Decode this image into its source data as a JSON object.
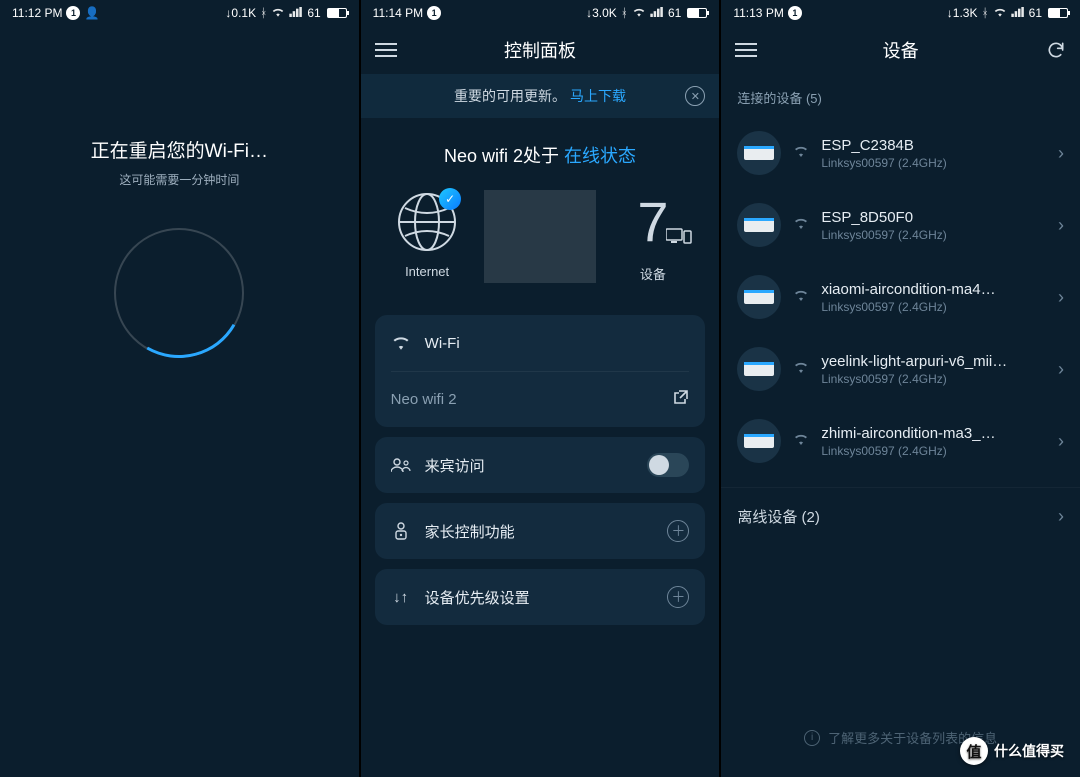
{
  "statusbar": {
    "s1": {
      "time": "11:12 PM",
      "notif": "1",
      "net": "↓0.1K",
      "battery_pct": 61,
      "battery_label": "61"
    },
    "s2": {
      "time": "11:14 PM",
      "notif": "1",
      "net": "↓3.0K",
      "battery_pct": 61,
      "battery_label": "61"
    },
    "s3": {
      "time": "11:13 PM",
      "notif": "1",
      "net": "↓1.3K",
      "battery_pct": 61,
      "battery_label": "61"
    }
  },
  "screen1": {
    "title": "正在重启您的Wi-Fi…",
    "subtitle": "这可能需要一分钟时间"
  },
  "screen2": {
    "nav_title": "控制面板",
    "update_text": "重要的可用更新。",
    "update_link": "马上下载",
    "status_prefix": "Neo wifi 2处于",
    "status_suffix": "在线状态",
    "internet_label": "Internet",
    "device_count": "7",
    "device_label": "设备",
    "wifi_card": {
      "title": "Wi-Fi",
      "ssid": "Neo wifi 2"
    },
    "guest": {
      "label": "来宾访问",
      "on": false
    },
    "parental": {
      "label": "家长控制功能"
    },
    "priority": {
      "label": "设备优先级设置"
    }
  },
  "screen3": {
    "nav_title": "设备",
    "connected_label": "连接的设备  (5)",
    "devices": [
      {
        "name": "ESP_C2384B",
        "sub": "Linksys00597  (2.4GHz)"
      },
      {
        "name": "ESP_8D50F0",
        "sub": "Linksys00597  (2.4GHz)"
      },
      {
        "name": "xiaomi-aircondition-ma4…",
        "sub": "Linksys00597  (2.4GHz)"
      },
      {
        "name": "yeelink-light-arpuri-v6_mii…",
        "sub": "Linksys00597  (2.4GHz)"
      },
      {
        "name": "zhimi-aircondition-ma3_…",
        "sub": "Linksys00597  (2.4GHz)"
      }
    ],
    "offline_label": "离线设备  (2)",
    "info_text": "了解更多关于设备列表的信息"
  },
  "watermark": {
    "badge": "值",
    "text": "什么值得买"
  }
}
